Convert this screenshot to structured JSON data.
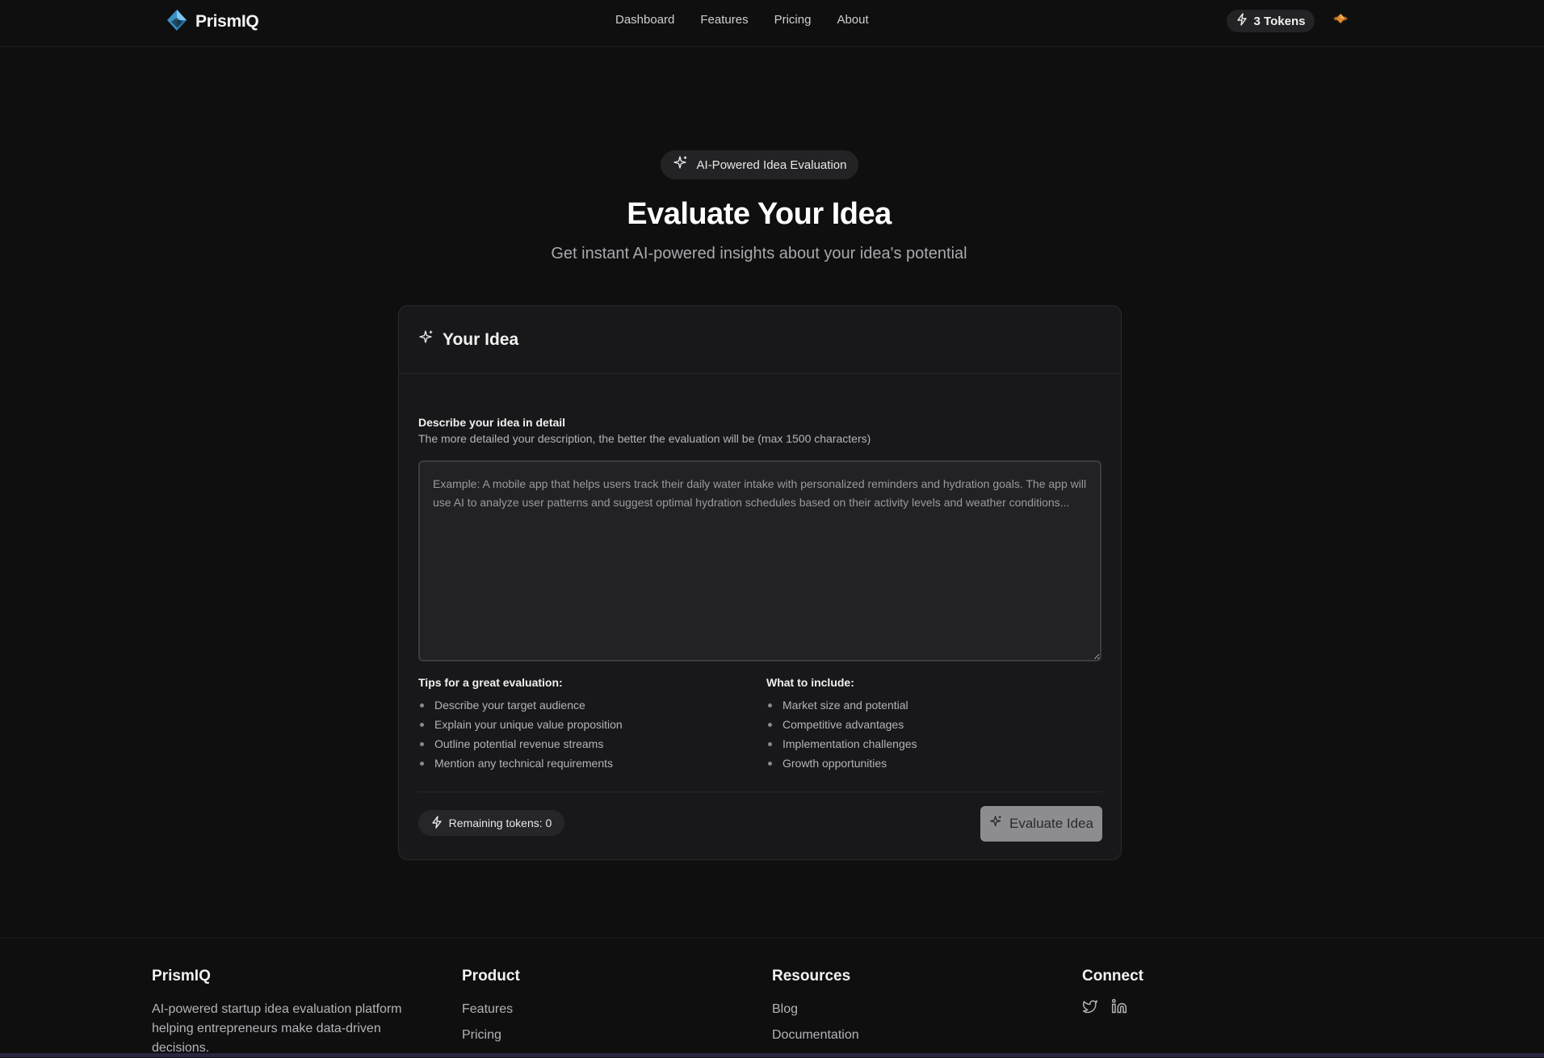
{
  "nav": {
    "brand": "PrismIQ",
    "links": [
      "Dashboard",
      "Features",
      "Pricing",
      "About"
    ],
    "tokens_label": "3 Tokens"
  },
  "hero": {
    "badge": "AI-Powered Idea Evaluation",
    "title": "Evaluate Your Idea",
    "subtitle": "Get instant AI-powered insights about your idea's potential"
  },
  "card": {
    "title": "Your Idea",
    "field_label": "Describe your idea in detail",
    "field_help": "The more detailed your description, the better the evaluation will be (max 1500 characters)",
    "textarea_value": "",
    "textarea_placeholder": "Example: A mobile app that helps users track their daily water intake with personalized reminders and hydration goals. The app will use AI to analyze user patterns and suggest optimal hydration schedules based on their activity levels and weather conditions...",
    "tips_heading": "Tips for a great evaluation:",
    "tips": [
      "Describe your target audience",
      "Explain your unique value proposition",
      "Outline potential revenue streams",
      "Mention any technical requirements"
    ],
    "include_heading": "What to include:",
    "include": [
      "Market size and potential",
      "Competitive advantages",
      "Implementation challenges",
      "Growth opportunities"
    ],
    "remaining_tokens": "Remaining tokens: 0",
    "evaluate_label": "Evaluate Idea"
  },
  "footer": {
    "brand": "PrismIQ",
    "description": "AI-powered startup idea evaluation platform helping entrepreneurs make data-driven decisions.",
    "product_heading": "Product",
    "product_links": [
      "Features",
      "Pricing"
    ],
    "resources_heading": "Resources",
    "resources_links": [
      "Blog",
      "Documentation"
    ],
    "connect_heading": "Connect",
    "social": [
      "twitter-icon",
      "linkedin-icon"
    ]
  },
  "colors": {
    "background": "#0f0f10",
    "card": "#18181a",
    "accent_logo": "#5ab4e6",
    "theme_toggle": "#d98a2b",
    "button_disabled": "#8d8d90"
  }
}
